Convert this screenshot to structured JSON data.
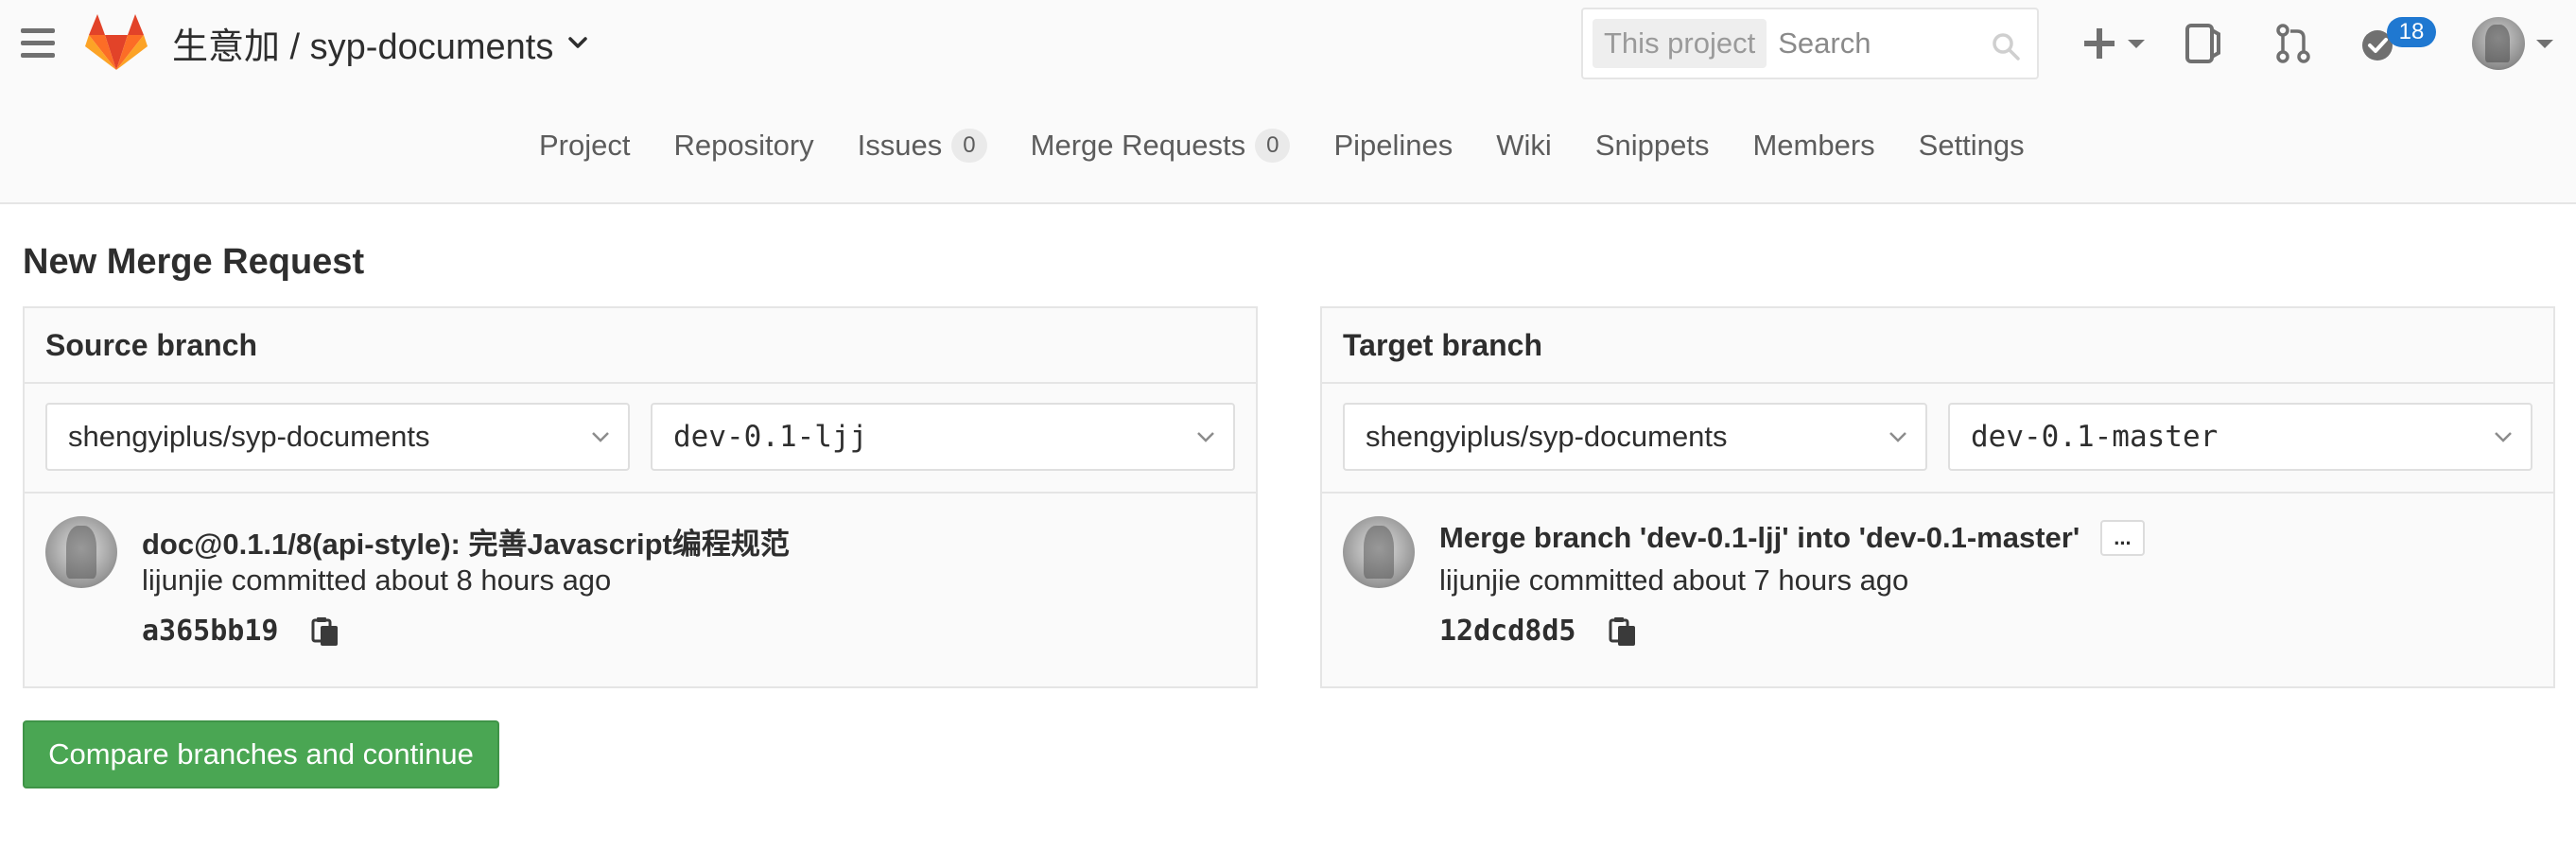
{
  "header": {
    "project_path": "生意加 / syp-documents",
    "search_scope": "This project",
    "search_placeholder": "Search",
    "todos_count": "18",
    "colors": {
      "logo_orange": "#e24329",
      "logo_light": "#fca326",
      "badge_blue": "#1f78d1"
    }
  },
  "nav": {
    "items": [
      {
        "label": "Project"
      },
      {
        "label": "Repository"
      },
      {
        "label": "Issues",
        "count": "0"
      },
      {
        "label": "Merge Requests",
        "count": "0"
      },
      {
        "label": "Pipelines"
      },
      {
        "label": "Wiki"
      },
      {
        "label": "Snippets"
      },
      {
        "label": "Members"
      },
      {
        "label": "Settings"
      }
    ]
  },
  "page": {
    "title": "New Merge Request",
    "compare_button": "Compare branches and continue",
    "button_color": "#4aa653"
  },
  "source": {
    "heading": "Source branch",
    "project": "shengyiplus/syp-documents",
    "branch": "dev-0.1-ljj",
    "commit": {
      "title": "doc@0.1.1/8(api-style): 完善Javascript编程规范",
      "meta": "lijunjie committed about 8 hours ago",
      "sha": "a365bb19"
    }
  },
  "target": {
    "heading": "Target branch",
    "project": "shengyiplus/syp-documents",
    "branch": "dev-0.1-master",
    "commit": {
      "title": "Merge branch 'dev-0.1-ljj' into 'dev-0.1-master'",
      "ellipsis": "...",
      "meta": "lijunjie committed about 7 hours ago",
      "sha": "12dcd8d5"
    }
  }
}
